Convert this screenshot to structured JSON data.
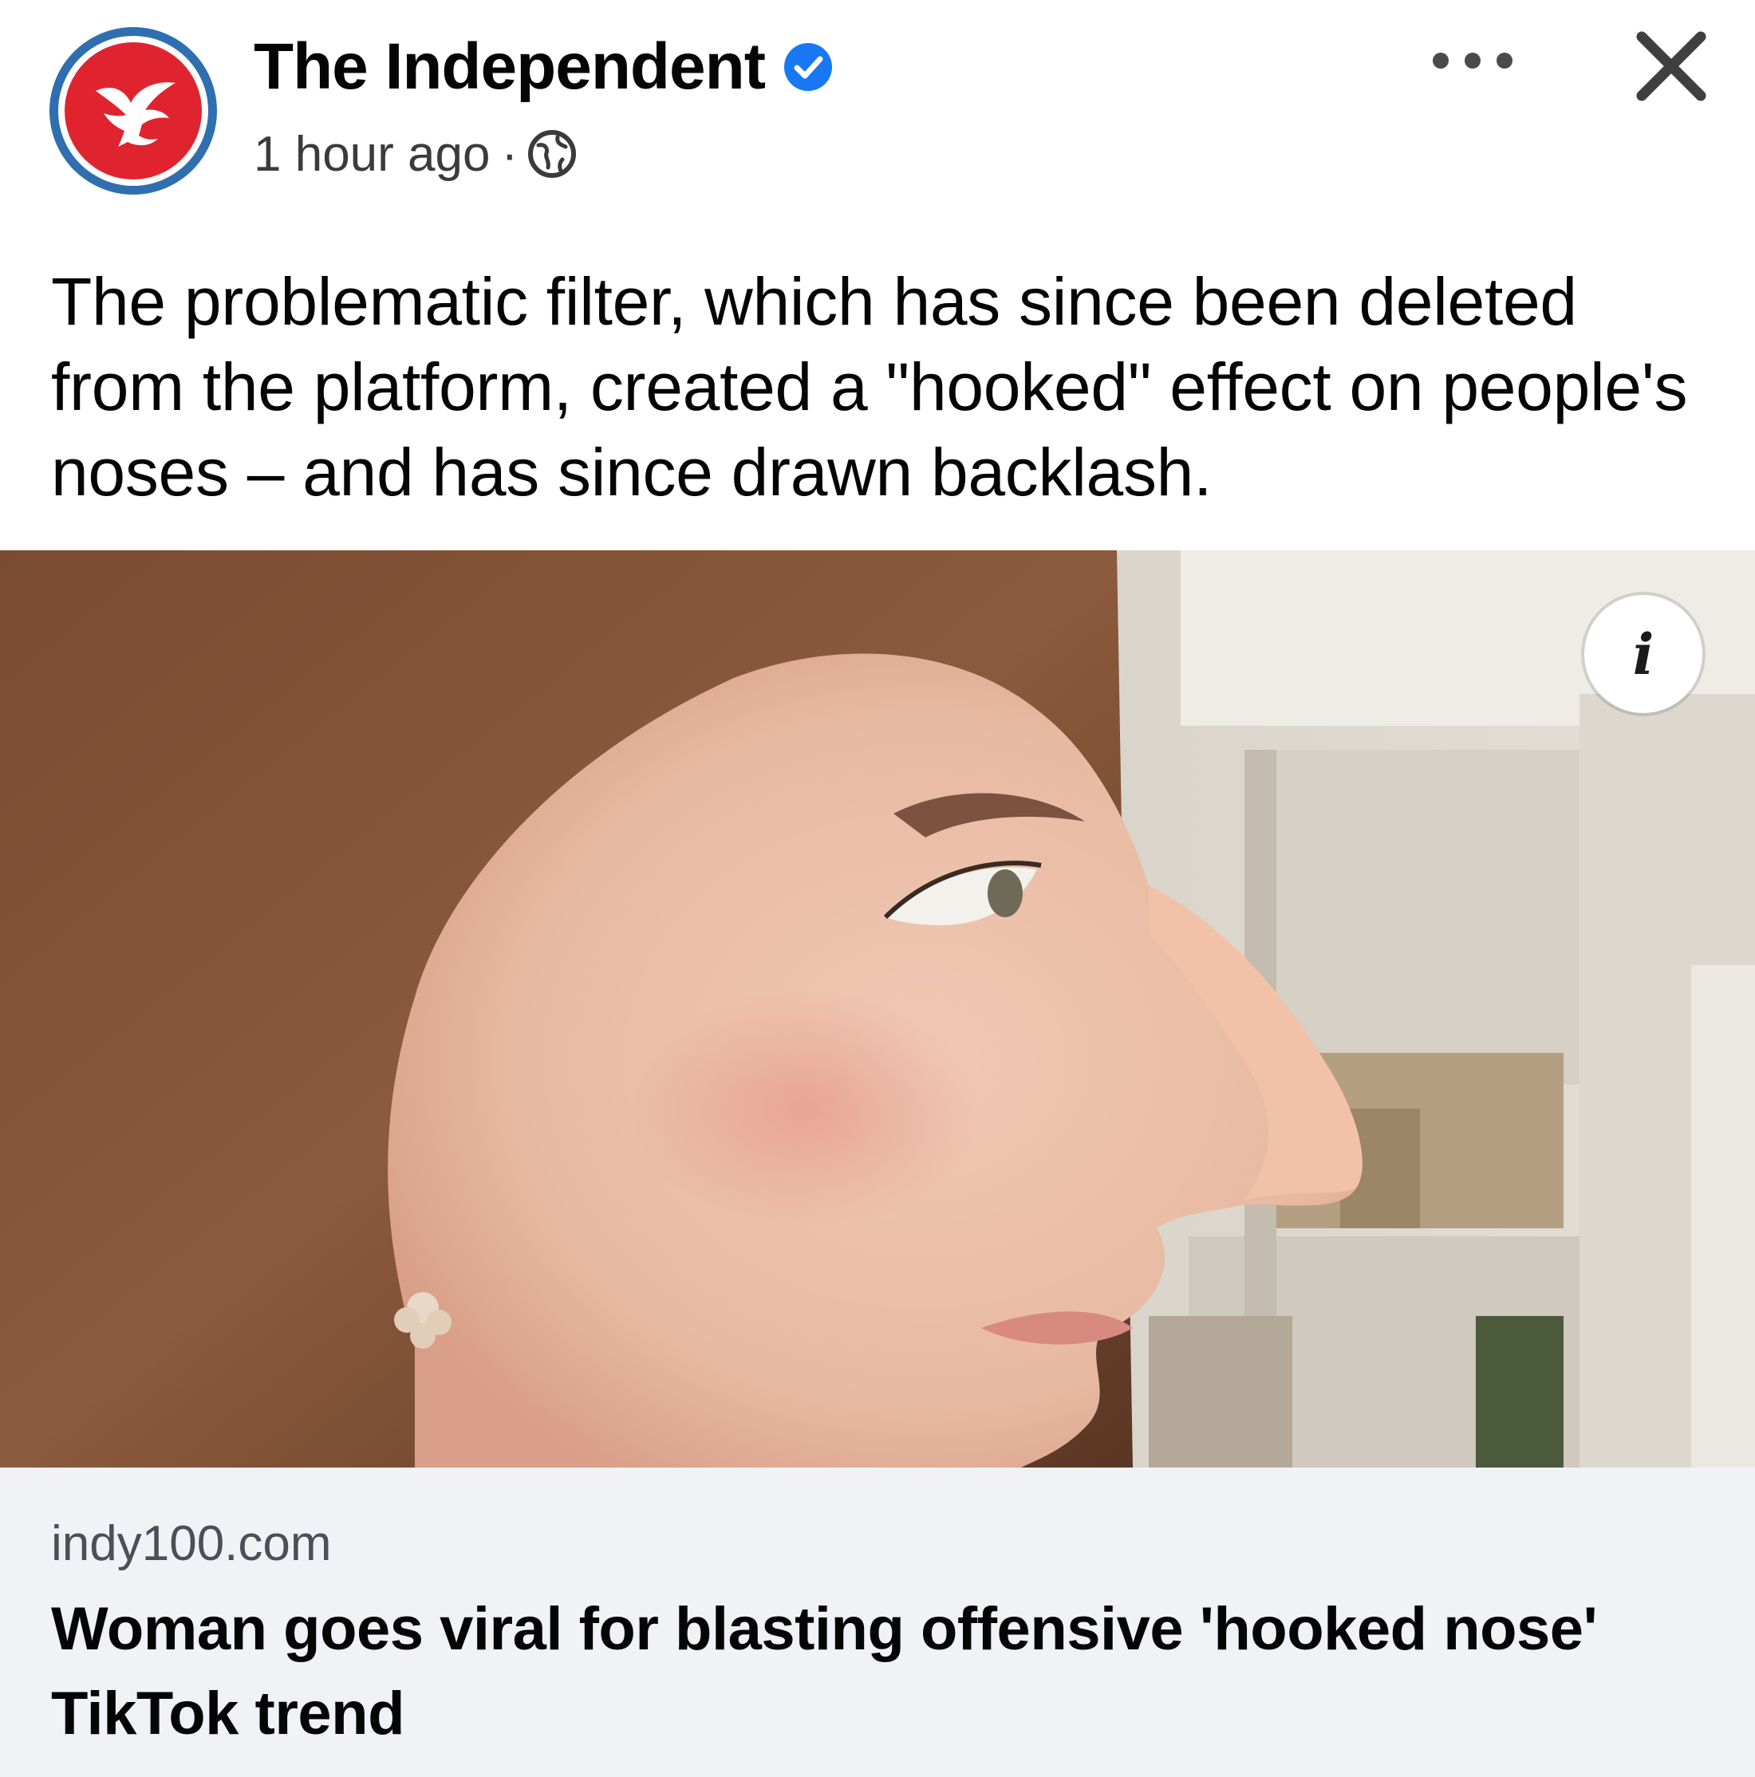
{
  "post": {
    "page_name": "The Independent",
    "verified_icon": "verified-badge-icon",
    "time": "1 hour ago",
    "separator": "·",
    "audience_icon": "globe-icon",
    "more_icon": "more-options-icon",
    "close_icon": "close-icon",
    "caption": "The problematic filter, which has since been deleted from the platform, created a \"hooked\" effect on people's noses – and has since drawn backlash.",
    "info_glyph": "i"
  },
  "link": {
    "domain": "indy100.com",
    "headline": "Woman goes viral for blasting offensive 'hooked nose' TikTok trend"
  },
  "colors": {
    "brand_red": "#e0242f",
    "avatar_ring": "#2f6fb0",
    "verified_blue": "#1877f2",
    "card_bg": "#f0f2f5"
  }
}
